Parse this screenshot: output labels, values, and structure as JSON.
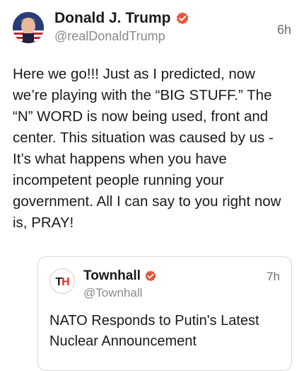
{
  "post": {
    "author": {
      "name": "Donald J. Trump",
      "handle": "@realDonaldTrump",
      "verified": true
    },
    "timestamp": "6h",
    "text": "Here we go!!! Just as I predicted, now we’re playing with the “BIG STUFF.” The “N” WORD is now being used, front and center. This situation was caused by us - It’s what happens when you have incompetent people running your government. All I can say to you right now is, PRAY!"
  },
  "quoted_post": {
    "author": {
      "name": "Townhall",
      "handle": "@Townhall",
      "avatar_text": "TH",
      "verified": true
    },
    "timestamp": "7h",
    "text": "NATO Responds to Putin's Latest Nuclear Announcement"
  },
  "colors": {
    "verified_badge": "#e8553d",
    "muted_text": "#8a8a8a",
    "brand_red": "#d92b2b"
  },
  "icons": {
    "verified": "verified-badge-icon"
  }
}
